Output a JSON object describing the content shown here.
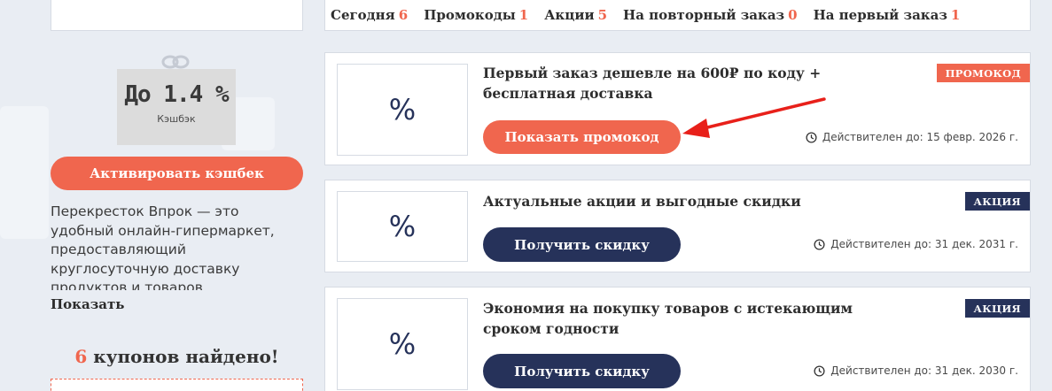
{
  "sidebar": {
    "cashback_value": "До 1.4 %",
    "cashback_label": "Кэшбэк",
    "activate_label": "Активировать кэшбек",
    "description": "Перекресток Впрок — это удобный онлайн-гипермаркет, предоставляющий круглосуточную доставку продуктов и товаров повседневного спроса по",
    "show_more": "Показать",
    "coupons_count": "6",
    "coupons_found_text": "купонов найдено!"
  },
  "filters": [
    {
      "label": "Сегодня",
      "count": "6"
    },
    {
      "label": "Промокоды",
      "count": "1"
    },
    {
      "label": "Акции",
      "count": "5"
    },
    {
      "label": "На повторный заказ",
      "count": "0"
    },
    {
      "label": "На первый заказ",
      "count": "1"
    }
  ],
  "coupons": [
    {
      "image_text": "%",
      "title": "Первый заказ дешевле на 600₽ по коду + бесплатная доставка",
      "badge": "ПРОМОКОД",
      "button": "Показать промокод",
      "valid": "Действителен до: 15 февр. 2026 г."
    },
    {
      "image_text": "%",
      "title": "Актуальные акции и выгодные скидки",
      "badge": "АКЦИЯ",
      "button": "Получить скидку",
      "valid": "Действителен до: 31 дек. 2031 г."
    },
    {
      "image_text": "%",
      "title": "Экономия на покупку товаров с истекающим сроком годности",
      "badge": "АКЦИЯ",
      "button": "Получить скидку",
      "valid": "Действителен до: 31 дек. 2030 г."
    }
  ],
  "colors": {
    "accent": "#f0664e",
    "navy": "#26325a",
    "background": "#e9edf3"
  }
}
